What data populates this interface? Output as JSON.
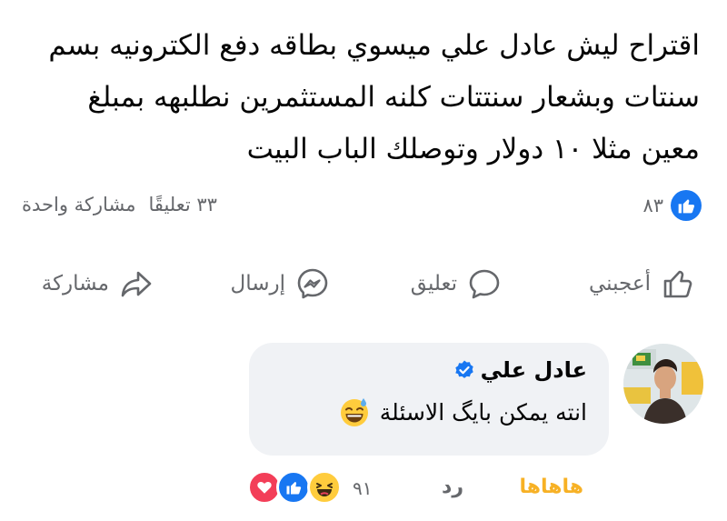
{
  "post": {
    "text": "اقتراح ليش عادل علي ميسوي بطاقه دفع  الكترونيه بسم سنتات وبشعار سنتتات كلنه المستثمرين نطلبهه بمبلغ معين مثلا ١٠ دولار وتوصلك الباب البيت"
  },
  "stats": {
    "likes_count": "٨٣",
    "comments": "٣٣ تعليقًا",
    "shares": "مشاركة واحدة"
  },
  "actions": {
    "like": "أعجبني",
    "comment": "تعليق",
    "send": "إرسال",
    "share": "مشاركة"
  },
  "comment": {
    "author": "عادل علي",
    "text": "انته يمكن بايگ الاسئلة",
    "haha_label": "هاهاها",
    "reply_label": "رد",
    "reactions_count": "٩١"
  },
  "colors": {
    "facebook_blue": "#1877f2",
    "haha_yellow": "#f7b125",
    "love_red": "#f33e58",
    "secondary_text": "#65676b",
    "bubble_bg": "#f0f2f5"
  },
  "icons": {
    "likes_badge": "thumbs-up-icon",
    "like_action": "thumbs-up-outline-icon",
    "comment_action": "speech-bubble-icon",
    "send_action": "messenger-icon",
    "share_action": "share-arrow-icon",
    "verified": "verified-badge-icon",
    "comment_emoji": "sweat-smile-emoji",
    "reactions": [
      "love-reaction-icon",
      "like-reaction-icon",
      "haha-reaction-icon"
    ]
  }
}
